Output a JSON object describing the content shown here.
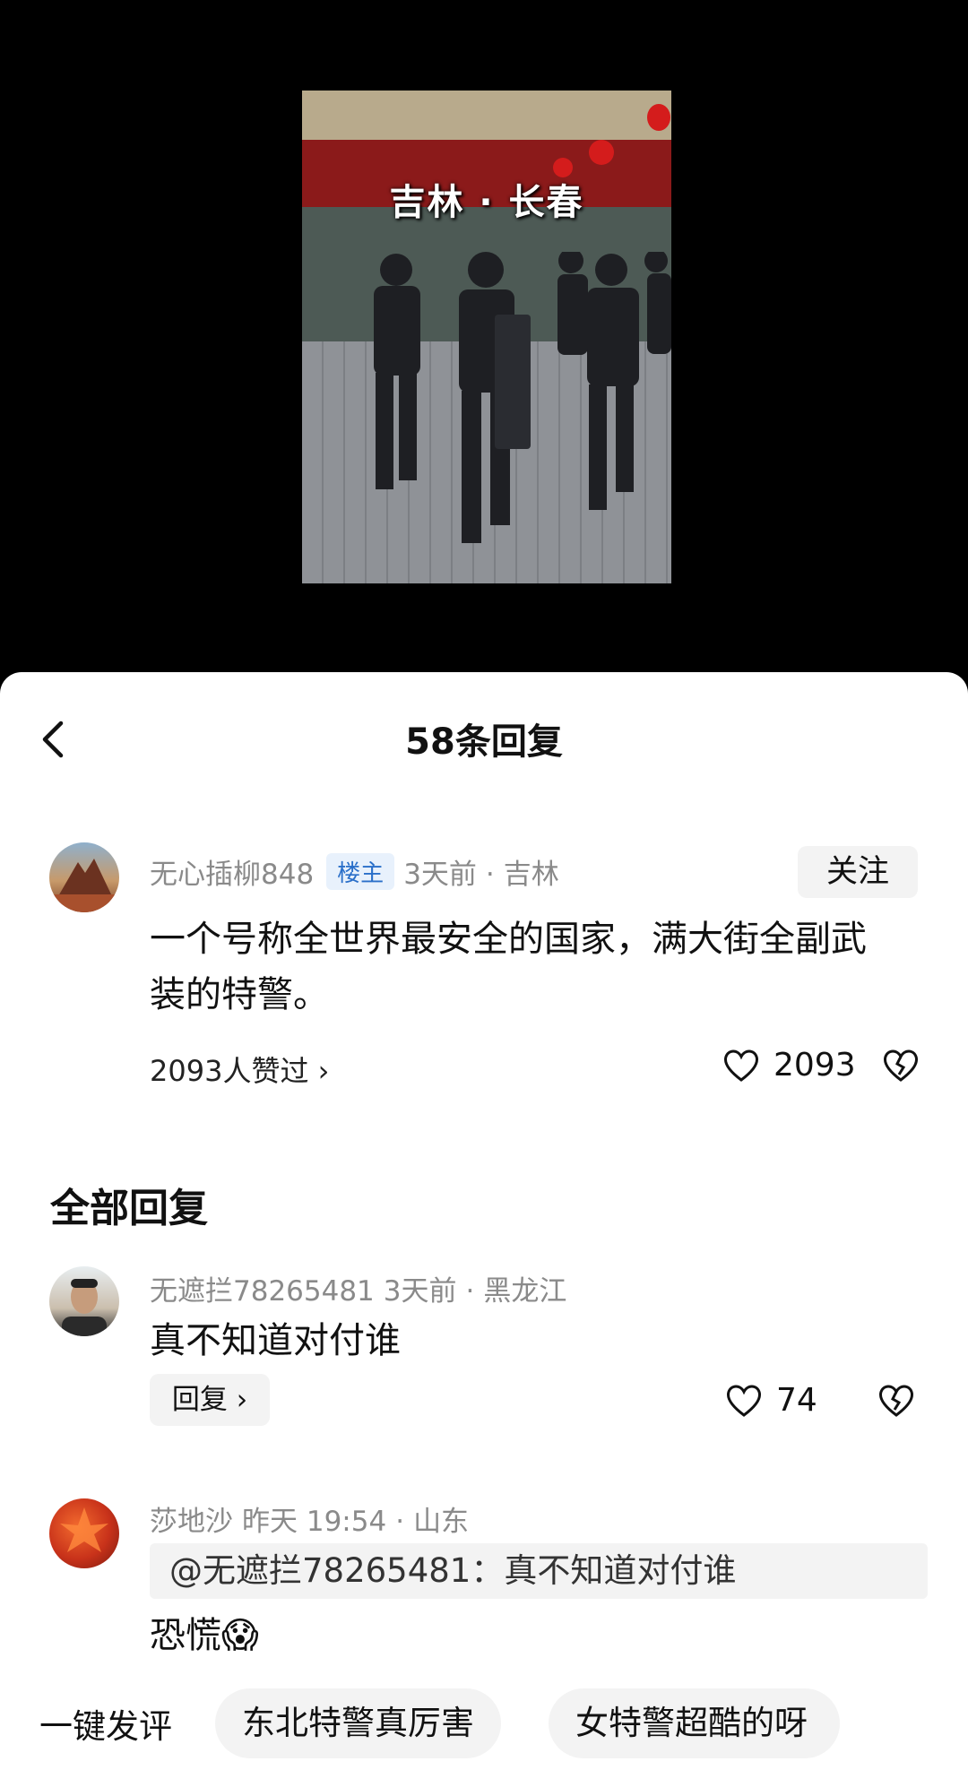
{
  "video": {
    "caption": "吉林 · 长春"
  },
  "header": {
    "title": "58条回复"
  },
  "main_comment": {
    "username": "无心插柳848",
    "badge": "楼主",
    "time": "3天前",
    "location": "吉林",
    "follow_label": "关注",
    "text": "一个号称全世界最安全的国家，满大街全副武装的特警。",
    "likes_summary": "2093人赞过 ›",
    "like_count": "2093"
  },
  "replies_heading": "全部回复",
  "replies": [
    {
      "username": "无遮拦78265481",
      "time": "3天前",
      "location": "黑龙江",
      "text": "真不知道对付谁",
      "reply_label": "回复 ›",
      "like_count": "74"
    },
    {
      "username": "莎地沙",
      "time": "昨天 19:54",
      "location": "山东",
      "quote": "@无遮拦78265481：真不知道对付谁",
      "text": "恐慌😱"
    }
  ],
  "quick_bar": {
    "label": "一键发评",
    "chips": [
      "东北特警真厉害",
      "女特警超酷的呀"
    ]
  },
  "colors": {
    "accent": "#2a6fc9",
    "meta_gray": "#8a8a8a",
    "chip_bg": "#f3f3f3"
  }
}
